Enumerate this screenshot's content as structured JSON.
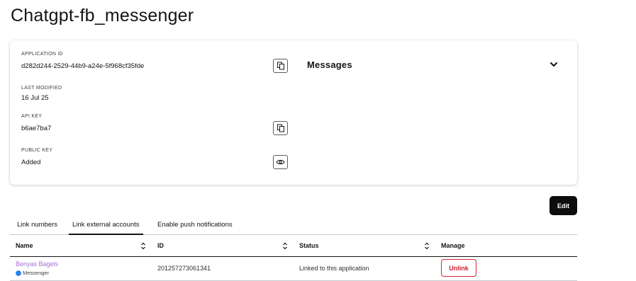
{
  "page": {
    "title": "Chatgpt-fb_messenger"
  },
  "details": {
    "application_id_label": "APPLICATION ID",
    "application_id": "d282d244-2529-44b9-a24e-5f968cf35fde",
    "last_modified_label": "LAST MODIFIED",
    "last_modified": "16 Jul 25",
    "api_key_label": "API KEY",
    "api_key": "b6ae7ba7",
    "public_key_label": "PUBLIC KEY",
    "public_key": "Added",
    "capability": "Messages"
  },
  "actions": {
    "edit_label": "Edit"
  },
  "tabs": [
    {
      "label": "Link numbers",
      "active": false
    },
    {
      "label": "Link external accounts",
      "active": true
    },
    {
      "label": "Enable push notifications",
      "active": false
    }
  ],
  "table": {
    "columns": [
      "Name",
      "ID",
      "Status",
      "Manage"
    ],
    "rows": [
      {
        "name": "Benyas Bagels",
        "platform": "Messenger",
        "id": "201257273061341",
        "status": "Linked to this application",
        "action": "Unlink"
      }
    ]
  },
  "colors": {
    "link_name": "#a46ed6",
    "danger": "#d6263a",
    "primary_button": "#0d0d0d",
    "messenger_icon": "#1877f2"
  },
  "icons": [
    "copy-icon",
    "eye-icon",
    "chevron-down-icon",
    "sort-icon",
    "messenger-icon"
  ]
}
